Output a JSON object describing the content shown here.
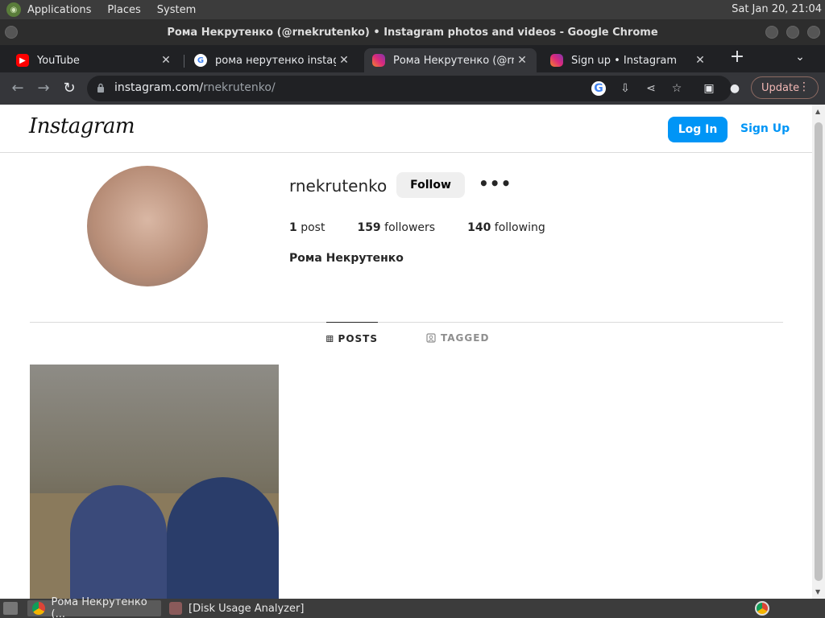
{
  "top_panel": {
    "menus": [
      "Applications",
      "Places",
      "System"
    ],
    "clock": "Sat Jan 20, 21:04"
  },
  "window": {
    "title": "Рома Некрутенко (@rnekrutenko) • Instagram photos and videos - Google Chrome"
  },
  "tabs": [
    {
      "label": "YouTube",
      "favicon": "youtube-icon",
      "active": false
    },
    {
      "label": "рома нерутенко instagram",
      "favicon": "google-icon",
      "active": false
    },
    {
      "label": "Рома Некрутенко (@rnekrutenko)",
      "favicon": "instagram-icon",
      "active": true
    },
    {
      "label": "Sign up • Instagram",
      "favicon": "instagram-icon",
      "active": false
    }
  ],
  "toolbar": {
    "url_host": "instagram.com/",
    "url_path": "rnekrutenko/",
    "update_label": "Update"
  },
  "instagram": {
    "logo": "Instagram",
    "login_label": "Log In",
    "signup_label": "Sign Up",
    "username": "rnekrutenko",
    "follow_label": "Follow",
    "more_label": "•••",
    "posts_count": "1",
    "posts_label": "post",
    "followers_count": "159",
    "followers_label": "followers",
    "following_count": "140",
    "following_label": "following",
    "full_name": "Рома Некрутенко",
    "tab_posts": "POSTS",
    "tab_tagged": "TAGGED"
  },
  "taskbar": {
    "items": [
      "Рома Некрутенко (...",
      "[Disk Usage Analyzer]"
    ]
  },
  "colors": {
    "ig_blue": "#0095f6",
    "chrome_dark": "#202124",
    "panel": "#3c3c3c"
  }
}
